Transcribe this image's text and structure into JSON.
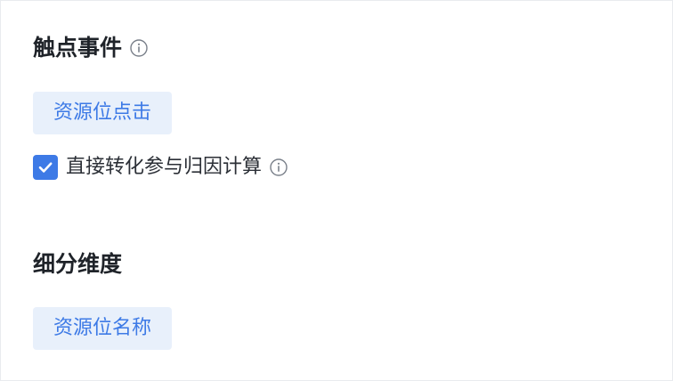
{
  "touch_event": {
    "title": "触点事件",
    "tag": "资源位点击",
    "checkbox_label": "直接转化参与归因计算",
    "checkbox_checked": true
  },
  "breakdown": {
    "title": "细分维度",
    "tag": "资源位名称"
  },
  "icons": {
    "info": "info-icon",
    "check": "check-icon"
  },
  "colors": {
    "accent": "#3d7ae6",
    "tag_bg": "#e8f0fb",
    "title_text": "#1f2329",
    "body_text": "#2b2f36",
    "icon_gray": "#7a808a"
  }
}
